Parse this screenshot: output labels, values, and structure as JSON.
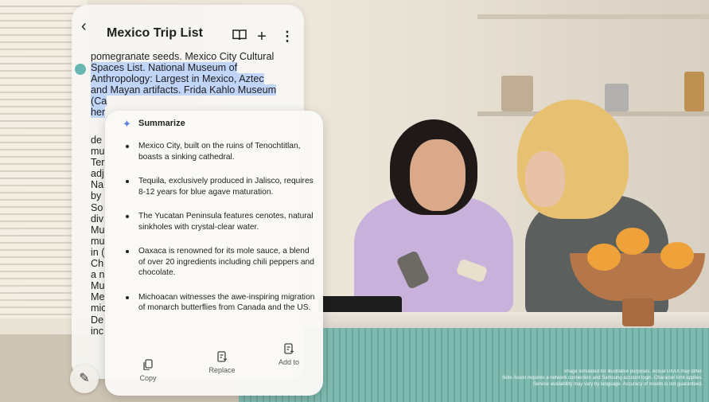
{
  "note": {
    "title": "Mexico Trip List",
    "lines": [
      "pomegranate seeds. Mexico City Cultural",
      "Spaces List. National Museum of",
      "Anthropology: Largest in Mexico, Aztec",
      "and Mayan artifacts. Frida Kahlo Museum",
      "(Ca",
      "her"
    ],
    "partial_lines": [
      "de",
      "mu",
      "Ter",
      "adj",
      "Na",
      "by",
      "So",
      "div",
      "Mu",
      "mu",
      "in (",
      "Ch",
      "a n",
      "Mu",
      "Me",
      "mic",
      "De",
      "inc"
    ]
  },
  "summarize": {
    "title": "Summarize",
    "items": [
      "Mexico City, built on the ruins of Tenochtitlan, boasts a sinking cathedral.",
      "Tequila, exclusively produced in Jalisco, requires 8-12 years for blue agave maturation.",
      "The Yucatan Peninsula features cenotes, natural sinkholes with crystal-clear water.",
      "Oaxaca is renowned for its mole sauce, a blend of over 20 ingredients including chili peppers and chocolate.",
      "Michoacan witnesses the awe-inspiring migration of monarch butterflies from Canada and the US."
    ],
    "actions": {
      "copy": "Copy",
      "replace": "Replace",
      "add_to": "Add to"
    }
  },
  "disclaimer": [
    "Image simulated for illustrative purposes. Actual UX/UI may differ.",
    "Note Assist requires a network connection and Samsung account login. Character limit applies.",
    "Service availability may vary by language. Accuracy of results is not guaranteed."
  ]
}
